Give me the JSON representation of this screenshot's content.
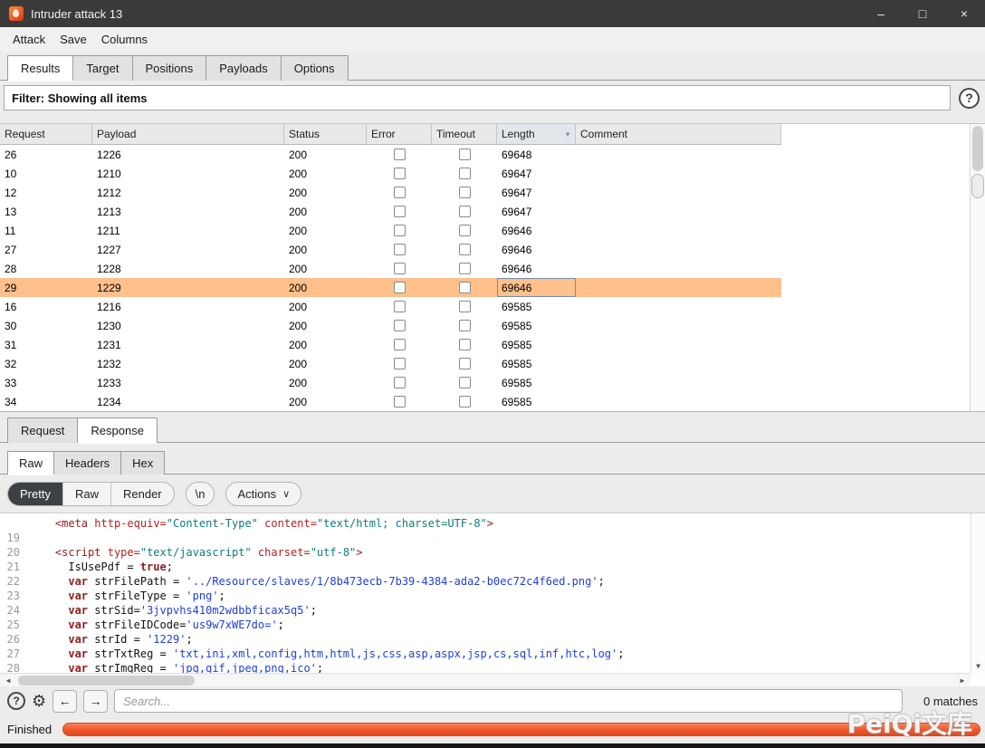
{
  "window": {
    "title": "Intruder attack 13",
    "controls": {
      "minimize": "–",
      "maximize": "□",
      "close": "×"
    }
  },
  "menu": {
    "items": [
      "Attack",
      "Save",
      "Columns"
    ]
  },
  "main_tabs": {
    "items": [
      "Results",
      "Target",
      "Positions",
      "Payloads",
      "Options"
    ],
    "selected": "Results"
  },
  "filter": {
    "label": "Filter: Showing all items",
    "help_icon": "?"
  },
  "table": {
    "columns": [
      "Request",
      "Payload",
      "Status",
      "Error",
      "Timeout",
      "Length",
      "Comment"
    ],
    "sorted_column": "Length",
    "sort_icon": "▼",
    "selected_request": "29",
    "rows": [
      {
        "request": "26",
        "payload": "1226",
        "status": "200",
        "error": false,
        "timeout": false,
        "length": "69648",
        "comment": ""
      },
      {
        "request": "10",
        "payload": "1210",
        "status": "200",
        "error": false,
        "timeout": false,
        "length": "69647",
        "comment": ""
      },
      {
        "request": "12",
        "payload": "1212",
        "status": "200",
        "error": false,
        "timeout": false,
        "length": "69647",
        "comment": ""
      },
      {
        "request": "13",
        "payload": "1213",
        "status": "200",
        "error": false,
        "timeout": false,
        "length": "69647",
        "comment": ""
      },
      {
        "request": "11",
        "payload": "1211",
        "status": "200",
        "error": false,
        "timeout": false,
        "length": "69646",
        "comment": ""
      },
      {
        "request": "27",
        "payload": "1227",
        "status": "200",
        "error": false,
        "timeout": false,
        "length": "69646",
        "comment": ""
      },
      {
        "request": "28",
        "payload": "1228",
        "status": "200",
        "error": false,
        "timeout": false,
        "length": "69646",
        "comment": ""
      },
      {
        "request": "29",
        "payload": "1229",
        "status": "200",
        "error": false,
        "timeout": false,
        "length": "69646",
        "comment": ""
      },
      {
        "request": "16",
        "payload": "1216",
        "status": "200",
        "error": false,
        "timeout": false,
        "length": "69585",
        "comment": ""
      },
      {
        "request": "30",
        "payload": "1230",
        "status": "200",
        "error": false,
        "timeout": false,
        "length": "69585",
        "comment": ""
      },
      {
        "request": "31",
        "payload": "1231",
        "status": "200",
        "error": false,
        "timeout": false,
        "length": "69585",
        "comment": ""
      },
      {
        "request": "32",
        "payload": "1232",
        "status": "200",
        "error": false,
        "timeout": false,
        "length": "69585",
        "comment": ""
      },
      {
        "request": "33",
        "payload": "1233",
        "status": "200",
        "error": false,
        "timeout": false,
        "length": "69585",
        "comment": ""
      },
      {
        "request": "34",
        "payload": "1234",
        "status": "200",
        "error": false,
        "timeout": false,
        "length": "69585",
        "comment": ""
      }
    ]
  },
  "message_tabs": {
    "items": [
      "Request",
      "Response"
    ],
    "selected": "Response"
  },
  "view_tabs": {
    "items": [
      "Raw",
      "Headers",
      "Hex"
    ],
    "selected": "Raw"
  },
  "toolbar": {
    "segments": [
      "Pretty",
      "Raw",
      "Render"
    ],
    "selected": "Pretty",
    "newline_label": "\\n",
    "actions_label": "Actions",
    "actions_chevron": "∨"
  },
  "editor": {
    "scroll": {
      "left_arrow": "◀",
      "right_arrow": "▶",
      "down_arrow": "▼"
    },
    "lines": [
      {
        "num": "",
        "segments": [
          {
            "t": "    ",
            "c": "plain"
          },
          {
            "t": "<meta",
            "c": "tag"
          },
          {
            "t": " ",
            "c": "plain"
          },
          {
            "t": "http-equiv=",
            "c": "attr"
          },
          {
            "t": "\"Content-Type\"",
            "c": "val"
          },
          {
            "t": " ",
            "c": "plain"
          },
          {
            "t": "content=",
            "c": "attr"
          },
          {
            "t": "\"text/html; charset=UTF-8\"",
            "c": "val"
          },
          {
            "t": ">",
            "c": "tag"
          }
        ]
      },
      {
        "num": "19",
        "segments": []
      },
      {
        "num": "20",
        "segments": [
          {
            "t": "    ",
            "c": "plain"
          },
          {
            "t": "<script",
            "c": "tag"
          },
          {
            "t": " ",
            "c": "plain"
          },
          {
            "t": "type=",
            "c": "attr"
          },
          {
            "t": "\"text/javascript\"",
            "c": "val"
          },
          {
            "t": " ",
            "c": "plain"
          },
          {
            "t": "charset=",
            "c": "attr"
          },
          {
            "t": "\"utf-8\"",
            "c": "val"
          },
          {
            "t": ">",
            "c": "tag"
          }
        ]
      },
      {
        "num": "21",
        "segments": [
          {
            "t": "      IsUsePdf = ",
            "c": "plain"
          },
          {
            "t": "true",
            "c": "kw"
          },
          {
            "t": ";",
            "c": "plain"
          }
        ]
      },
      {
        "num": "22",
        "segments": [
          {
            "t": "      ",
            "c": "plain"
          },
          {
            "t": "var",
            "c": "kw"
          },
          {
            "t": " strFilePath = ",
            "c": "plain"
          },
          {
            "t": "'../Resource/slaves/1/8b473ecb-7b39-4384-ada2-b0ec72c4f6ed.png'",
            "c": "str"
          },
          {
            "t": ";",
            "c": "plain"
          }
        ]
      },
      {
        "num": "23",
        "segments": [
          {
            "t": "      ",
            "c": "plain"
          },
          {
            "t": "var",
            "c": "kw"
          },
          {
            "t": " strFileType = ",
            "c": "plain"
          },
          {
            "t": "'png'",
            "c": "str"
          },
          {
            "t": ";",
            "c": "plain"
          }
        ]
      },
      {
        "num": "24",
        "segments": [
          {
            "t": "      ",
            "c": "plain"
          },
          {
            "t": "var",
            "c": "kw"
          },
          {
            "t": " strSid=",
            "c": "plain"
          },
          {
            "t": "'3jvpvhs410m2wdbbficax5q5'",
            "c": "str"
          },
          {
            "t": ";",
            "c": "plain"
          }
        ]
      },
      {
        "num": "25",
        "segments": [
          {
            "t": "      ",
            "c": "plain"
          },
          {
            "t": "var",
            "c": "kw"
          },
          {
            "t": " strFileIDCode=",
            "c": "plain"
          },
          {
            "t": "'us9w7xWE7do='",
            "c": "str"
          },
          {
            "t": ";",
            "c": "plain"
          }
        ]
      },
      {
        "num": "26",
        "segments": [
          {
            "t": "      ",
            "c": "plain"
          },
          {
            "t": "var",
            "c": "kw"
          },
          {
            "t": " strId = ",
            "c": "plain"
          },
          {
            "t": "'1229'",
            "c": "str"
          },
          {
            "t": ";",
            "c": "plain"
          }
        ]
      },
      {
        "num": "27",
        "segments": [
          {
            "t": "      ",
            "c": "plain"
          },
          {
            "t": "var",
            "c": "kw"
          },
          {
            "t": " strTxtReg = ",
            "c": "plain"
          },
          {
            "t": "'txt,ini,xml,config,htm,html,js,css,asp,aspx,jsp,cs,sql,inf,htc,log'",
            "c": "str"
          },
          {
            "t": ";",
            "c": "plain"
          }
        ]
      },
      {
        "num": "28",
        "segments": [
          {
            "t": "      ",
            "c": "plain"
          },
          {
            "t": "var",
            "c": "kw"
          },
          {
            "t": " strImgReg = ",
            "c": "plain"
          },
          {
            "t": "'jpg,gif,jpeg,png,ico'",
            "c": "str"
          },
          {
            "t": ";",
            "c": "plain"
          }
        ]
      }
    ]
  },
  "search": {
    "help_icon": "?",
    "gear_icon": "⚙",
    "back_label": "←",
    "forward_label": "→",
    "placeholder": "Search...",
    "matches": "0 matches"
  },
  "status": {
    "label": "Finished",
    "progress_color": "#ee5527"
  },
  "watermark": {
    "text": "PeiQi文库"
  }
}
